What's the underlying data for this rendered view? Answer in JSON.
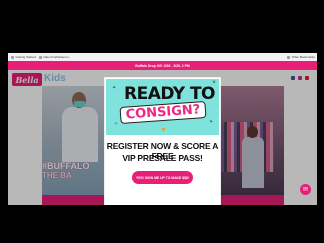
{
  "bookmarks": {
    "left": [
      {
        "label": "Getting Started",
        "icon": "globe-icon"
      },
      {
        "label": "https://curbsidecon...",
        "icon": "page-icon"
      }
    ],
    "right": {
      "label": "Other Bookmarks",
      "icon": "folder-icon"
    }
  },
  "promo_bar": {
    "text": "Buffalo Drop Off: 3/18 - 3/20, 2 PM"
  },
  "site": {
    "logo_text": "Bella",
    "logo_tail": "Kids",
    "hashtag_line1": "#BUFFALO",
    "hashtag_line2": "THE BA",
    "socials": [
      "facebook-icon",
      "instagram-icon",
      "youtube-icon"
    ],
    "colors": {
      "brand_pink": "#e81f76",
      "teal": "#7fe2dc",
      "kids_blue": "#8fc3e8"
    }
  },
  "modal": {
    "close_label": "×",
    "headline_top": "READY TO",
    "headline_bottom": "CONSIGN?",
    "body_line1": "REGISTER NOW & SCORE A FREE",
    "body_line2": "VIP PRESALE PASS!",
    "button_label": "YES! SIGN ME UP TO MAKE $$$!"
  },
  "chat": {
    "icon": "chat-icon",
    "glyph": "✉"
  }
}
